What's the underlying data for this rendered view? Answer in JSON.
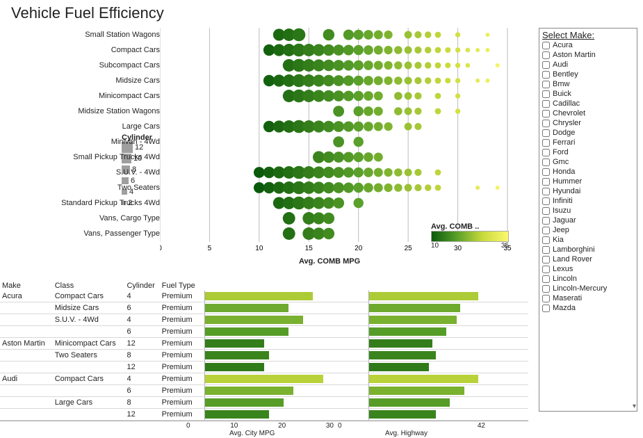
{
  "title": "Vehicle Fuel Efficiency",
  "selectMake": {
    "title": "Select Make:",
    "items": [
      "Acura",
      "Aston Martin",
      "Audi",
      "Bentley",
      "Bmw",
      "Buick",
      "Cadillac",
      "Chevrolet",
      "Chrysler",
      "Dodge",
      "Ferrari",
      "Ford",
      "Gmc",
      "Honda",
      "Hummer",
      "Hyundai",
      "Infiniti",
      "Isuzu",
      "Jaguar",
      "Jeep",
      "Kia",
      "Lamborghini",
      "Land Rover",
      "Lexus",
      "Lincoln",
      "Lincoln-Mercury",
      "Maserati",
      "Mazda"
    ]
  },
  "dotPlot": {
    "xlabel": "Avg. COMB MPG",
    "xmin": 0,
    "xmax": 35,
    "xticks": [
      0,
      5,
      10,
      15,
      20,
      25,
      30,
      35
    ],
    "categories": [
      "Small Station Wagons",
      "Compact Cars",
      "Subcompact Cars",
      "Midsize Cars",
      "Minicompact Cars",
      "Midsize Station Wagons",
      "Large Cars",
      "Minivan - 4Wd",
      "Small Pickup Trucks 4Wd",
      "S.U.V. - 4Wd",
      "Two Seaters",
      "Standard Pickup Trucks 4Wd",
      "Vans, Cargo Type",
      "Vans, Passenger Type"
    ]
  },
  "cylinderLegend": {
    "title": "Cylinder",
    "sizes": [
      12,
      10,
      8,
      6,
      4,
      2
    ]
  },
  "colorLegend": {
    "title": "Avg. COMB ..",
    "min": 10,
    "max": 35
  },
  "tableHeaders": {
    "make": "Make",
    "class": "Class",
    "cylinder": "Cylinder",
    "fuel": "Fuel Type"
  },
  "barCharts": {
    "xmax_city": 30,
    "xmax_hwy": 42,
    "xticks_city": [
      0,
      10,
      20,
      30
    ],
    "xticks_hwy": [
      0,
      42
    ],
    "xlabel_city": "Avg. City MPG",
    "xlabel_hwy": "Avg. Highway"
  },
  "rows": [
    {
      "make": "Acura",
      "class": "Compact Cars",
      "cyl": 4,
      "fuel": "Premium",
      "city": 22,
      "hwy": 31
    },
    {
      "make": "",
      "class": "Midsize Cars",
      "cyl": 6,
      "fuel": "Premium",
      "city": 17,
      "hwy": 26
    },
    {
      "make": "",
      "class": "S.U.V. - 4Wd",
      "cyl": 4,
      "fuel": "Premium",
      "city": 20,
      "hwy": 25
    },
    {
      "make": "",
      "class": "",
      "cyl": 6,
      "fuel": "Premium",
      "city": 17,
      "hwy": 22
    },
    {
      "make": "Aston Martin",
      "class": "Minicompact Cars",
      "cyl": 12,
      "fuel": "Premium",
      "city": 12,
      "hwy": 18
    },
    {
      "make": "",
      "class": "Two Seaters",
      "cyl": 8,
      "fuel": "Premium",
      "city": 13,
      "hwy": 19
    },
    {
      "make": "",
      "class": "",
      "cyl": 12,
      "fuel": "Premium",
      "city": 12,
      "hwy": 17
    },
    {
      "make": "Audi",
      "class": "Compact Cars",
      "cyl": 4,
      "fuel": "Premium",
      "city": 24,
      "hwy": 31
    },
    {
      "make": "",
      "class": "",
      "cyl": 6,
      "fuel": "Premium",
      "city": 18,
      "hwy": 27
    },
    {
      "make": "",
      "class": "Large Cars",
      "cyl": 8,
      "fuel": "Premium",
      "city": 16,
      "hwy": 23
    },
    {
      "make": "",
      "class": "",
      "cyl": 12,
      "fuel": "Premium",
      "city": 13,
      "hwy": 19
    }
  ],
  "chart_data": {
    "type": "scatter",
    "title": "Vehicle Fuel Efficiency",
    "xlabel": "Avg. COMB MPG",
    "ylabel": "",
    "xlim": [
      0,
      35
    ],
    "size_encodes": "Cylinder",
    "color_encodes": "Avg. COMB MPG",
    "color_scale": [
      10,
      35
    ],
    "series": [
      {
        "name": "Small Station Wagons",
        "x": [
          12,
          13,
          14,
          17,
          19,
          20,
          21,
          22,
          23,
          25,
          26,
          27,
          28,
          30,
          33
        ]
      },
      {
        "name": "Compact Cars",
        "x": [
          11,
          12,
          13,
          14,
          15,
          16,
          17,
          18,
          19,
          20,
          21,
          22,
          23,
          24,
          25,
          26,
          27,
          28,
          29,
          30,
          31,
          32,
          33
        ]
      },
      {
        "name": "Subcompact Cars",
        "x": [
          13,
          14,
          15,
          16,
          17,
          18,
          19,
          20,
          21,
          22,
          23,
          24,
          25,
          26,
          27,
          28,
          29,
          30,
          31,
          34
        ]
      },
      {
        "name": "Midsize Cars",
        "x": [
          11,
          12,
          13,
          14,
          15,
          16,
          17,
          18,
          19,
          20,
          21,
          22,
          23,
          24,
          25,
          26,
          27,
          28,
          29,
          30,
          32,
          33
        ]
      },
      {
        "name": "Minicompact Cars",
        "x": [
          13,
          14,
          15,
          16,
          17,
          18,
          19,
          20,
          21,
          22,
          24,
          25,
          26,
          28,
          30
        ]
      },
      {
        "name": "Midsize Station Wagons",
        "x": [
          18,
          20,
          21,
          22,
          24,
          25,
          26,
          28,
          30
        ]
      },
      {
        "name": "Large Cars",
        "x": [
          11,
          12,
          13,
          14,
          15,
          16,
          17,
          18,
          19,
          20,
          21,
          22,
          23,
          25,
          26
        ]
      },
      {
        "name": "Minivan - 4Wd",
        "x": [
          18,
          20
        ]
      },
      {
        "name": "Small Pickup Trucks 4Wd",
        "x": [
          16,
          17,
          18,
          19,
          20,
          21,
          22
        ]
      },
      {
        "name": "S.U.V. - 4Wd",
        "x": [
          10,
          11,
          12,
          13,
          14,
          15,
          16,
          17,
          18,
          19,
          20,
          21,
          22,
          23,
          24,
          25,
          26,
          28
        ]
      },
      {
        "name": "Two Seaters",
        "x": [
          10,
          11,
          12,
          13,
          14,
          15,
          16,
          17,
          18,
          19,
          20,
          21,
          22,
          23,
          24,
          25,
          26,
          27,
          28,
          32,
          34
        ]
      },
      {
        "name": "Standard Pickup Trucks 4Wd",
        "x": [
          12,
          13,
          14,
          15,
          16,
          17,
          18,
          20
        ]
      },
      {
        "name": "Vans, Cargo Type",
        "x": [
          13,
          15,
          16,
          17
        ]
      },
      {
        "name": "Vans, Passenger Type",
        "x": [
          13,
          15,
          16,
          17
        ]
      }
    ]
  }
}
